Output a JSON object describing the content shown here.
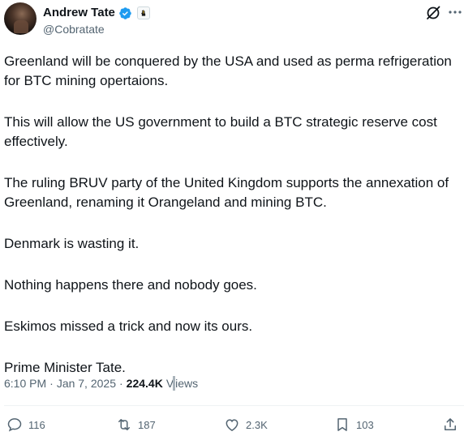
{
  "author": {
    "display_name": "Andrew Tate",
    "handle": "@Cobratate"
  },
  "tweet": {
    "paragraphs": [
      "Greenland will be conquered by the USA and used as perma refrigeration for BTC mining opertaions.",
      "This will allow the US government to build a BTC strategic reserve cost effectively.",
      "The ruling BRUV party of the United Kingdom supports the annexation of Greenland, renaming it Orangeland and mining BTC.",
      "Denmark is wasting it.",
      "Nothing happens there and nobody goes.",
      "Eskimos missed a trick and now its ours.",
      "Prime Minister Tate."
    ]
  },
  "meta": {
    "time": "6:10 PM",
    "separator": "·",
    "date": "Jan 7, 2025",
    "views_count": "224.4K",
    "views_label_pre": "V",
    "views_label_post": "iews"
  },
  "actions": {
    "replies": "116",
    "reposts": "187",
    "likes": "2.3K",
    "bookmarks": "103"
  },
  "colors": {
    "verified": "#1d9bf0",
    "secondary_text": "#536471",
    "primary_text": "#0f1419"
  },
  "icons": [
    "verified-badge-icon",
    "affiliate-badge-icon",
    "grok-icon",
    "more-options-icon",
    "reply-icon",
    "repost-icon",
    "like-icon",
    "bookmark-icon",
    "share-icon"
  ]
}
